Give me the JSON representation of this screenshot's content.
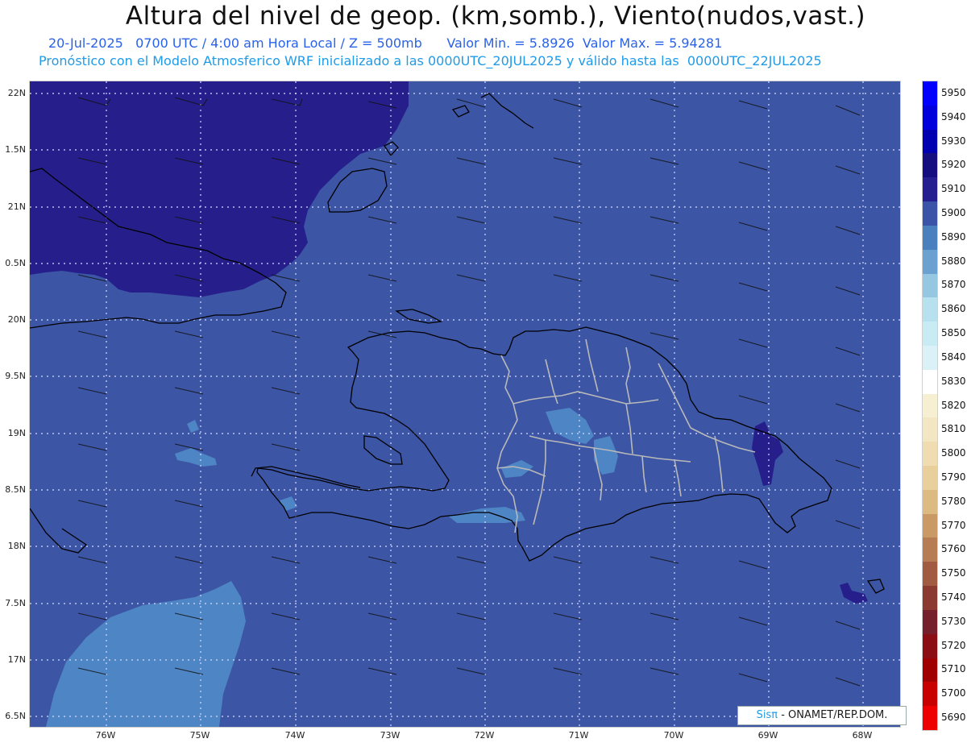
{
  "title": "Altura del nivel de geop. (km,somb.), Viento(nudos,vast.)",
  "subtitle": "20-Jul-2025   0700 UTC / 4:00 am Hora Local / Z = 500mb      Valor Min. = 5.8926  Valor Max. = 5.94281",
  "subtitle2": "Pronóstico con el Modelo Atmosferico WRF inicializado a las 0000UTC_20JUL2025 y válido hasta las  0000UTC_22JUL2025",
  "credit": {
    "prefix": "Sisπ",
    "suffix": " - ONAMET/REP.DOM."
  },
  "lat_labels": [
    "22N",
    "1.5N",
    "21N",
    "0.5N",
    "20N",
    "9.5N",
    "19N",
    "8.5N",
    "18N",
    "7.5N",
    "17N",
    "6.5N"
  ],
  "lon_labels": [
    "76W",
    "75W",
    "74W",
    "73W",
    "72W",
    "71W",
    "70W",
    "69W",
    "68W"
  ],
  "colorbar": {
    "labels": [
      "5950",
      "5940",
      "5930",
      "5920",
      "5910",
      "5900",
      "5890",
      "5880",
      "5870",
      "5860",
      "5850",
      "5840",
      "5830",
      "5820",
      "5810",
      "5800",
      "5790",
      "5780",
      "5770",
      "5760",
      "5750",
      "5740",
      "5730",
      "5720",
      "5710",
      "5700",
      "5690"
    ],
    "colors": [
      "#0000ff",
      "#0000dd",
      "#0000b0",
      "#140e80",
      "#261f8f",
      "#3b54a8",
      "#4b80bf",
      "#6aa1d0",
      "#95c6e2",
      "#b7e1ef",
      "#c9ebf3",
      "#daf2f7",
      "#ffffff",
      "#f7efd2",
      "#f3e6c2",
      "#efdcb1",
      "#e8cf9c",
      "#dcba82",
      "#c99a66",
      "#b67d54",
      "#a05b40",
      "#8a3a30",
      "#75202a",
      "#8a0e14",
      "#a00000",
      "#c80000",
      "#ee0000"
    ]
  },
  "colors": {
    "field": "#3c55a5",
    "high": "#261f8b",
    "low": "#4e85c4",
    "grid": "#d6dcff"
  }
}
